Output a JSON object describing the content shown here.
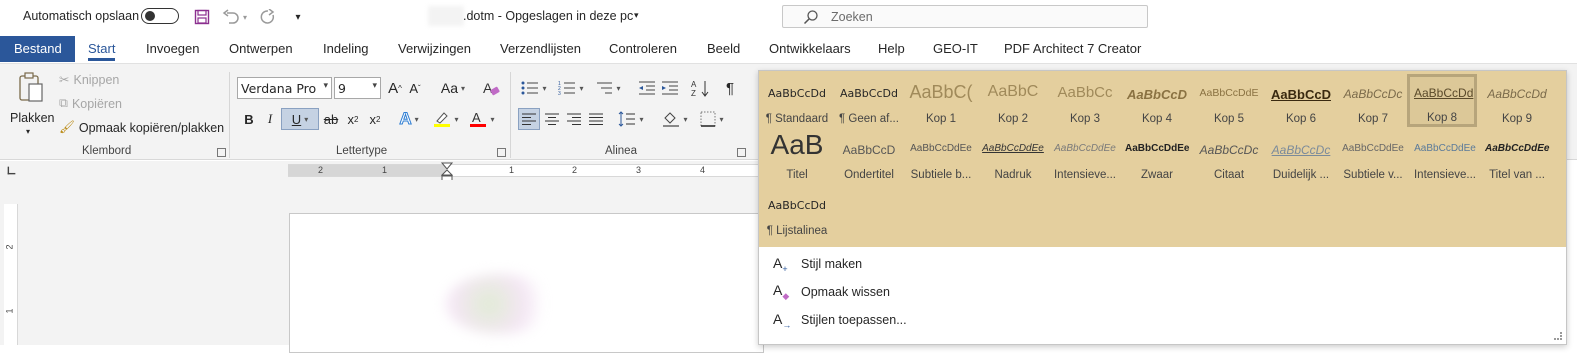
{
  "titlebar": {
    "autosave_label": "Automatisch opslaan",
    "doc_title": ".dotm  -  Opgeslagen in deze pc",
    "search_placeholder": "Zoeken"
  },
  "tabs": [
    {
      "label": "Bestand"
    },
    {
      "label": "Start"
    },
    {
      "label": "Invoegen"
    },
    {
      "label": "Ontwerpen"
    },
    {
      "label": "Indeling"
    },
    {
      "label": "Verwijzingen"
    },
    {
      "label": "Verzendlijsten"
    },
    {
      "label": "Controleren"
    },
    {
      "label": "Beeld"
    },
    {
      "label": "Ontwikkelaars"
    },
    {
      "label": "Help"
    },
    {
      "label": "GEO-IT"
    },
    {
      "label": "PDF Architect 7 Creator"
    }
  ],
  "clipboard": {
    "group_label": "Klembord",
    "paste": "Plakken",
    "cut": "Knippen",
    "copy": "Kopiëren",
    "format_painter": "Opmaak kopiëren/plakken"
  },
  "font": {
    "group_label": "Lettertype",
    "font_name": "Verdana Pro",
    "font_size": "9",
    "grow": "A",
    "shrink": "A",
    "case": "Aa",
    "bold": "B",
    "italic": "I",
    "underline": "U",
    "strike": "ab",
    "subscript": "x",
    "superscript": "x"
  },
  "paragraph": {
    "group_label": "Alinea",
    "pilcrow": "¶"
  },
  "ruler": {
    "numbers": [
      "2",
      "1",
      "1",
      "1",
      "2",
      "3",
      "4"
    ],
    "v_numbers": [
      "2",
      "1"
    ]
  },
  "styles": {
    "row1": [
      {
        "sample": "AaBbCcDd",
        "name": "¶ Standaard"
      },
      {
        "sample": "AaBbCcDd",
        "name": "¶ Geen af..."
      },
      {
        "sample": "AaBbC(",
        "name": "Kop 1"
      },
      {
        "sample": "AaBbC",
        "name": "Kop 2"
      },
      {
        "sample": "AaBbCc",
        "name": "Kop 3"
      },
      {
        "sample": "AaBbCcD",
        "name": "Kop 4"
      },
      {
        "sample": "AaBbCcDdE",
        "name": "Kop 5"
      },
      {
        "sample": "AaBbCcD",
        "name": "Kop 6"
      },
      {
        "sample": "AaBbCcDc",
        "name": "Kop 7"
      },
      {
        "sample": "AaBbCcDd",
        "name": "Kop 8"
      },
      {
        "sample": "AaBbCcDd",
        "name": "Kop 9"
      }
    ],
    "row2": [
      {
        "sample": "AaB",
        "name": "Titel"
      },
      {
        "sample": "AaBbCcD",
        "name": "Ondertitel"
      },
      {
        "sample": "AaBbCcDdEe",
        "name": "Subtiele b..."
      },
      {
        "sample": "AaBbCcDdEe",
        "name": "Nadruk"
      },
      {
        "sample": "AaBbCcDdEe",
        "name": "Intensieve..."
      },
      {
        "sample": "AaBbCcDdEe",
        "name": "Zwaar"
      },
      {
        "sample": "AaBbCcDc",
        "name": "Citaat"
      },
      {
        "sample": "AaBbCcDc",
        "name": "Duidelijk ..."
      },
      {
        "sample": "AaBbCcDdEe",
        "name": "Subtiele v..."
      },
      {
        "sample": "AaBbCcDdEe",
        "name": "Intensieve..."
      },
      {
        "sample": "AaBbCcDdEe",
        "name": "Titel van ..."
      }
    ],
    "row3": [
      {
        "sample": "AaBbCcDd",
        "name": "¶ Lijstalinea"
      }
    ],
    "selected": "Kop 8",
    "commands": [
      {
        "label": "Stijl maken",
        "icon": "create-style-icon"
      },
      {
        "label": "Opmaak wissen",
        "icon": "clear-formatting-icon"
      },
      {
        "label": "Stijlen toepassen...",
        "icon": "apply-styles-icon"
      }
    ]
  },
  "colors": {
    "accent": "#2b579a",
    "gallery_bg": "#e4cf9e",
    "highlight": "#ffff00",
    "font_color": "#ff0000"
  }
}
